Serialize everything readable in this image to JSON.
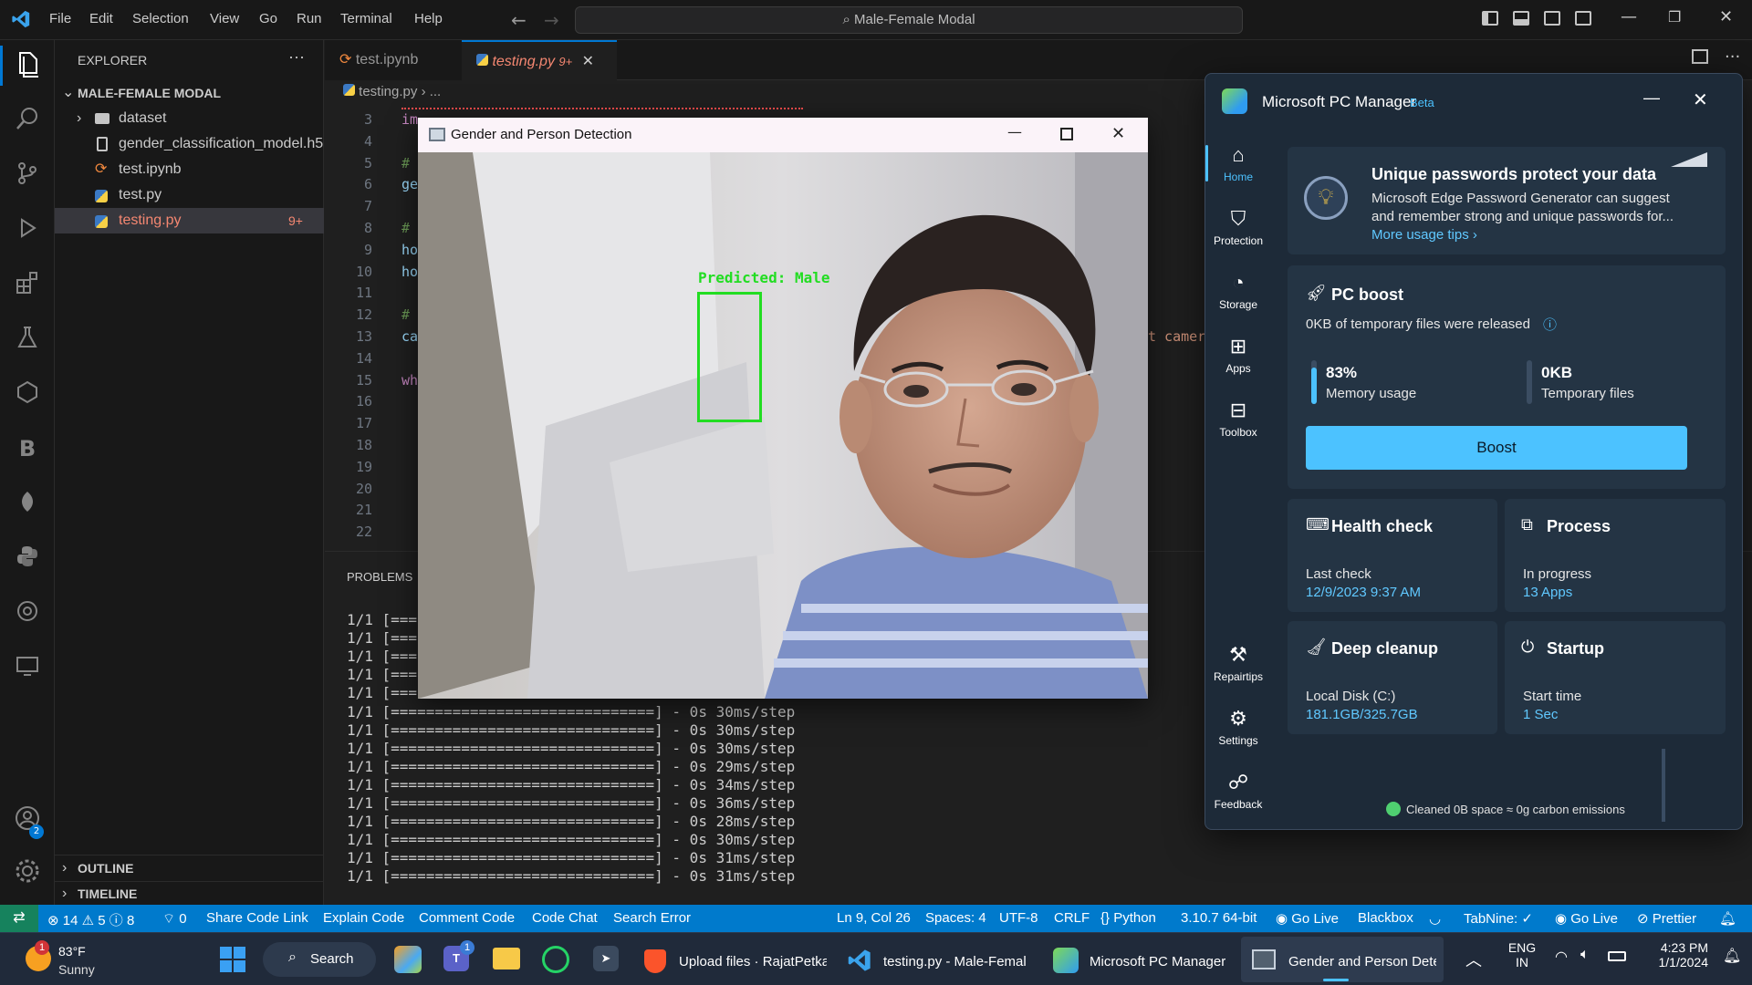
{
  "titlebar": {
    "menus": [
      "File",
      "Edit",
      "Selection",
      "View",
      "Go",
      "Run",
      "Terminal",
      "Help"
    ],
    "command_center": "Male-Female Modal"
  },
  "sidebar": {
    "header": "EXPLORER",
    "more": "···",
    "folder": "MALE-FEMALE MODAL",
    "items": [
      {
        "label": "dataset",
        "type": "folder"
      },
      {
        "label": "gender_classification_model.h5",
        "type": "file"
      },
      {
        "label": "test.ipynb",
        "type": "notebook"
      },
      {
        "label": "test.py",
        "type": "python"
      },
      {
        "label": "testing.py",
        "type": "python",
        "badge": "9+"
      }
    ],
    "outline": "OUTLINE",
    "timeline": "TIMELINE"
  },
  "tabs": [
    {
      "label": "test.ipynb"
    },
    {
      "label": "testing.py",
      "badge": "9+",
      "close": "✕"
    }
  ],
  "breadcrumb": {
    "file": "testing.py",
    "rest": "› ..."
  },
  "editor": {
    "line_numbers": [
      "3",
      "4",
      "5",
      "6",
      "7",
      "8",
      "9",
      "10",
      "11",
      "12",
      "13",
      "14",
      "15",
      "16",
      "17",
      "18",
      "19",
      "20",
      "21",
      "22"
    ],
    "code_fragments": [
      {
        "line": "3",
        "text": "im"
      },
      {
        "line": "5",
        "text": "#"
      },
      {
        "line": "6",
        "text": "ge"
      },
      {
        "line": "8",
        "text": "#"
      },
      {
        "line": "9",
        "text": "ho"
      },
      {
        "line": "10",
        "text": "ho"
      },
      {
        "line": "12",
        "text": "#"
      },
      {
        "line": "13",
        "text": "ca"
      },
      {
        "line": "15",
        "text": "wh"
      }
    ],
    "right_fragment": "t camer"
  },
  "panel": {
    "tab": "PROBLEMS",
    "lines": [
      "1/1 [===",
      "1/1 [===",
      "1/1 [===",
      "1/1 [===",
      "1/1 [===",
      "1/1 [==============================] - 0s 30ms/step",
      "1/1 [==============================] - 0s 30ms/step",
      "1/1 [==============================] - 0s 30ms/step",
      "1/1 [==============================] - 0s 29ms/step",
      "1/1 [==============================] - 0s 34ms/step",
      "1/1 [==============================] - 0s 36ms/step",
      "1/1 [==============================] - 0s 28ms/step",
      "1/1 [==============================] - 0s 30ms/step",
      "1/1 [==============================] - 0s 31ms/step",
      "1/1 [==============================] - 0s 31ms/step"
    ]
  },
  "statusbar": {
    "errors": "14",
    "warnings": "5",
    "info": "8",
    "ports": "0",
    "items_left": [
      "Share Code Link",
      "Explain Code",
      "Comment Code",
      "Code Chat",
      "Search Error"
    ],
    "position": "Ln 9, Col 26",
    "spaces": "Spaces: 4",
    "encoding": "UTF-8",
    "eol": "CRLF",
    "language": "Python",
    "interpreter": "3.10.7 64-bit",
    "go_live": "Go Live",
    "blackbox": "Blackbox",
    "tabnine": "TabNine: ✓",
    "go_live2": "Go Live",
    "prettier": "Prettier"
  },
  "camera_window": {
    "title": "Gender and Person Detection",
    "prediction": "Predicted: Male",
    "box_color": "#22dd22"
  },
  "pc_manager": {
    "title": "Microsoft PC Manager",
    "badge": "Beta",
    "nav": [
      "Home",
      "Protection",
      "Storage",
      "Apps",
      "Toolbox",
      "Repairtips",
      "Settings",
      "Feedback"
    ],
    "tip": {
      "title": "Unique passwords protect your data",
      "body1": "Microsoft Edge Password Generator can suggest",
      "body2": "and remember strong and unique passwords for...",
      "link": "More usage tips ›"
    },
    "boost": {
      "title": "PC boost",
      "subtitle": "0KB of temporary files were released",
      "memory_value": "83%",
      "memory_label": "Memory usage",
      "memory_fraction": 0.83,
      "temp_value": "0KB",
      "temp_label": "Temporary files",
      "button": "Boost"
    },
    "health": {
      "title": "Health check",
      "label": "Last check",
      "value": "12/9/2023 9:37 AM"
    },
    "process": {
      "title": "Process",
      "label": "In progress",
      "value": "13 Apps"
    },
    "cleanup": {
      "title": "Deep cleanup",
      "label": "Local Disk (C:)",
      "value": "181.1GB/325.7GB"
    },
    "startup": {
      "title": "Startup",
      "label": "Start time",
      "value": "1 Sec"
    },
    "footer": "Cleaned 0B space ≈ 0g carbon emissions",
    "accent": "#4cc2ff"
  },
  "taskbar": {
    "weather_temp": "83°F",
    "weather_desc": "Sunny",
    "weather_badge": "1",
    "search": "Search",
    "teams_badge": "1",
    "apps": [
      {
        "label": "Upload files · RajatPetka"
      },
      {
        "label": "testing.py - Male-Femal"
      },
      {
        "label": "Microsoft PC Manager"
      },
      {
        "label": "Gender and Person Dete"
      }
    ],
    "lang1": "ENG",
    "lang2": "IN",
    "time": "4:23 PM",
    "date": "1/1/2024"
  },
  "activity": {
    "account_badge": "2"
  }
}
